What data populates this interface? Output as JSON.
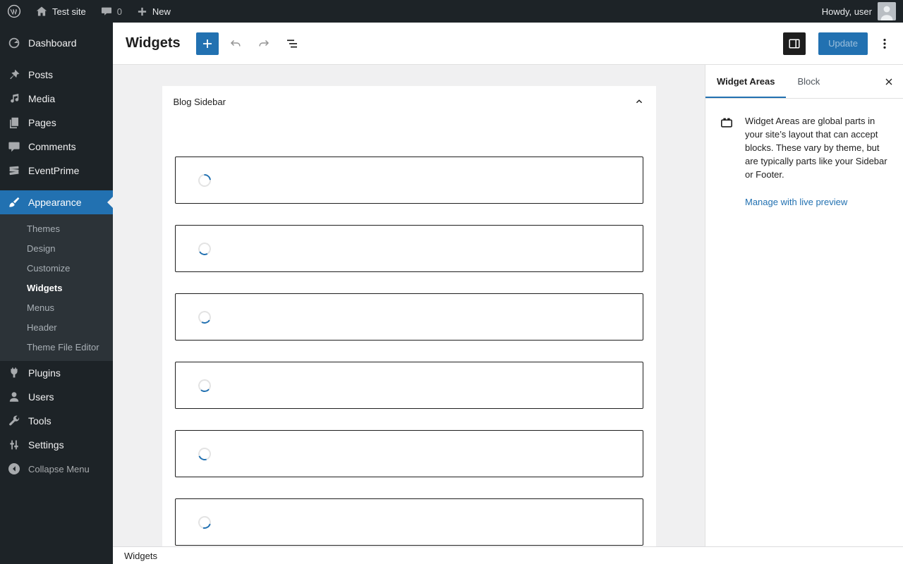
{
  "admin_bar": {
    "site_name": "Test site",
    "comment_count": "0",
    "new_label": "New",
    "greeting": "Howdy, user"
  },
  "sidebar": {
    "items": [
      {
        "label": "Dashboard"
      },
      {
        "label": "Posts"
      },
      {
        "label": "Media"
      },
      {
        "label": "Pages"
      },
      {
        "label": "Comments"
      },
      {
        "label": "EventPrime"
      },
      {
        "label": "Appearance",
        "active": true
      },
      {
        "label": "Plugins"
      },
      {
        "label": "Users"
      },
      {
        "label": "Tools"
      },
      {
        "label": "Settings"
      }
    ],
    "appearance_submenu": [
      {
        "label": "Themes"
      },
      {
        "label": "Design"
      },
      {
        "label": "Customize"
      },
      {
        "label": "Widgets",
        "current": true
      },
      {
        "label": "Menus"
      },
      {
        "label": "Header"
      },
      {
        "label": "Theme File Editor"
      }
    ],
    "collapse_label": "Collapse Menu"
  },
  "editor": {
    "title": "Widgets",
    "update_label": "Update"
  },
  "canvas": {
    "widget_area_title": "Blog Sidebar",
    "loading_blocks": 6
  },
  "inspector": {
    "tabs": [
      {
        "label": "Widget Areas",
        "active": true
      },
      {
        "label": "Block"
      }
    ],
    "description": "Widget Areas are global parts in your site’s layout that can accept blocks. These vary by theme, but are typically parts like your Sidebar or Footer.",
    "manage_link": "Manage with live preview"
  },
  "footer": {
    "breadcrumb": "Widgets"
  },
  "colors": {
    "accent": "#2271b1",
    "admin_bar_bg": "#1d2327",
    "submenu_bg": "#2c3338",
    "canvas_bg": "#f0f0f1"
  }
}
